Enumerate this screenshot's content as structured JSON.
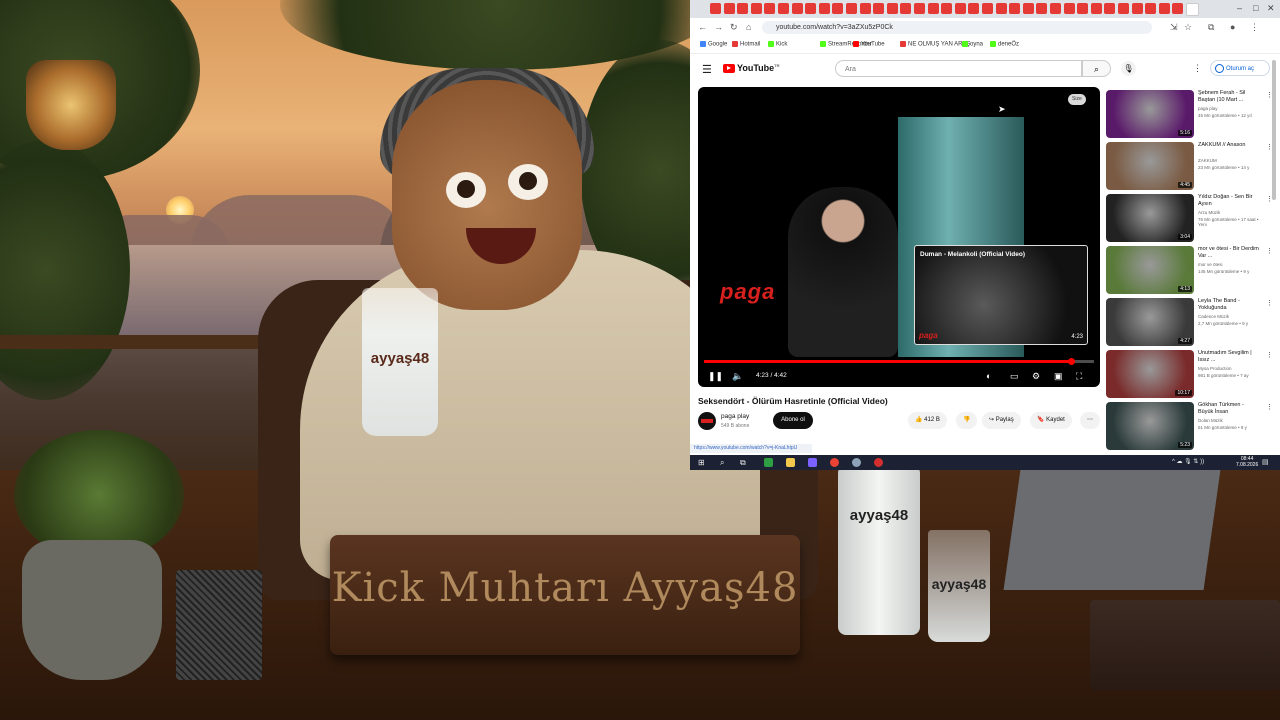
{
  "overlay": {
    "nameplate": "Kick Muhtarı Ayyaş48",
    "glass_label": "ayyaş48",
    "bottle_label": "ayyaş48",
    "small_glass_label": "ayyaş48"
  },
  "browser": {
    "url": "youtube.com/watch?v=3aZXu5zP0Ck",
    "bookmarks": [
      {
        "label": "Google",
        "color": "#4285f4"
      },
      {
        "label": "Hotmail",
        "color": "#e53935"
      },
      {
        "label": "Kick",
        "color": "#53fc18"
      },
      {
        "label": "StreamRecorder",
        "color": "#53fc18"
      },
      {
        "label": "YouTube",
        "color": "#ff0000"
      },
      {
        "label": "NE OLMUŞ YAN ARAŞ",
        "color": "#e53935"
      },
      {
        "label": "oyna",
        "color": "#53fc18"
      },
      {
        "label": "deneÖz",
        "color": "#53fc18"
      }
    ]
  },
  "youtube": {
    "logo": "YouTube",
    "logo_sup": "TR",
    "search_placeholder": "Ara",
    "signin": "Oturum aç",
    "size_badge": "Size",
    "player": {
      "brand": "paga",
      "time": "4:23 / 4:42",
      "progress": 0.94,
      "endcard_title": "Duman - Melankoli (Official Video)",
      "endcard_duration": "4:23",
      "endcard_brand": "paga"
    },
    "video_title": "Seksendört - Ölürüm Hasretinle (Official Video)",
    "channel": {
      "name": "paga play",
      "subs": "549 B abone"
    },
    "subscribe": "Abone ol",
    "like_count": "412 B",
    "share": "Paylaş",
    "save": "Kaydet",
    "status_url": "https://www.youtube.com/watch?v=j-KnaLhtpU",
    "related": [
      {
        "title": "Şebnem Ferah - Sil Baştan (10 Mart ...",
        "channel": "paga play",
        "meta": "45 Mn görüntüleme • 12 yıl",
        "duration": "5:16",
        "color": "#5a1a6a"
      },
      {
        "title": "ZAKKUM // Anason",
        "channel": "ZAKKUM",
        "meta": "23 Mn görüntüleme • 14 y",
        "duration": "4:45",
        "color": "#7a5a42"
      },
      {
        "title": "Yıldız Doğan - Sen Bir Aysın",
        "channel": "Arzu Müzik",
        "meta": "76 Mn görüntüleme • 17 saat • Yeni",
        "duration": "3:04",
        "color": "#222222"
      },
      {
        "title": "mor ve ötesi - Bir Derdim Var ...",
        "channel": "mor ve ötesi",
        "meta": "145 Mn görüntüleme • 9 y",
        "duration": "4:13",
        "color": "#5a7a3a"
      },
      {
        "title": "Leyla The Band - Yokluğunda",
        "channel": "Cadence Müzik",
        "meta": "2,7 Mn görüntüleme • 9 y",
        "duration": "4:27",
        "color": "#3a3a3a"
      },
      {
        "title": "Unutmadım Sevgilim | Issız ...",
        "channel": "Mysa Production",
        "meta": "981 B görüntüleme • 7 ay",
        "duration": "10:17",
        "color": "#7a2a2a"
      },
      {
        "title": "Gökhan Türkmen - Büyük İnsan",
        "channel": "Dolan Müzik",
        "meta": "51 Mn görüntüleme • 9 y",
        "duration": "5:23",
        "color": "#2a3a3a"
      }
    ]
  },
  "taskbar": {
    "time": "08:44",
    "date": "7.08.2026"
  }
}
